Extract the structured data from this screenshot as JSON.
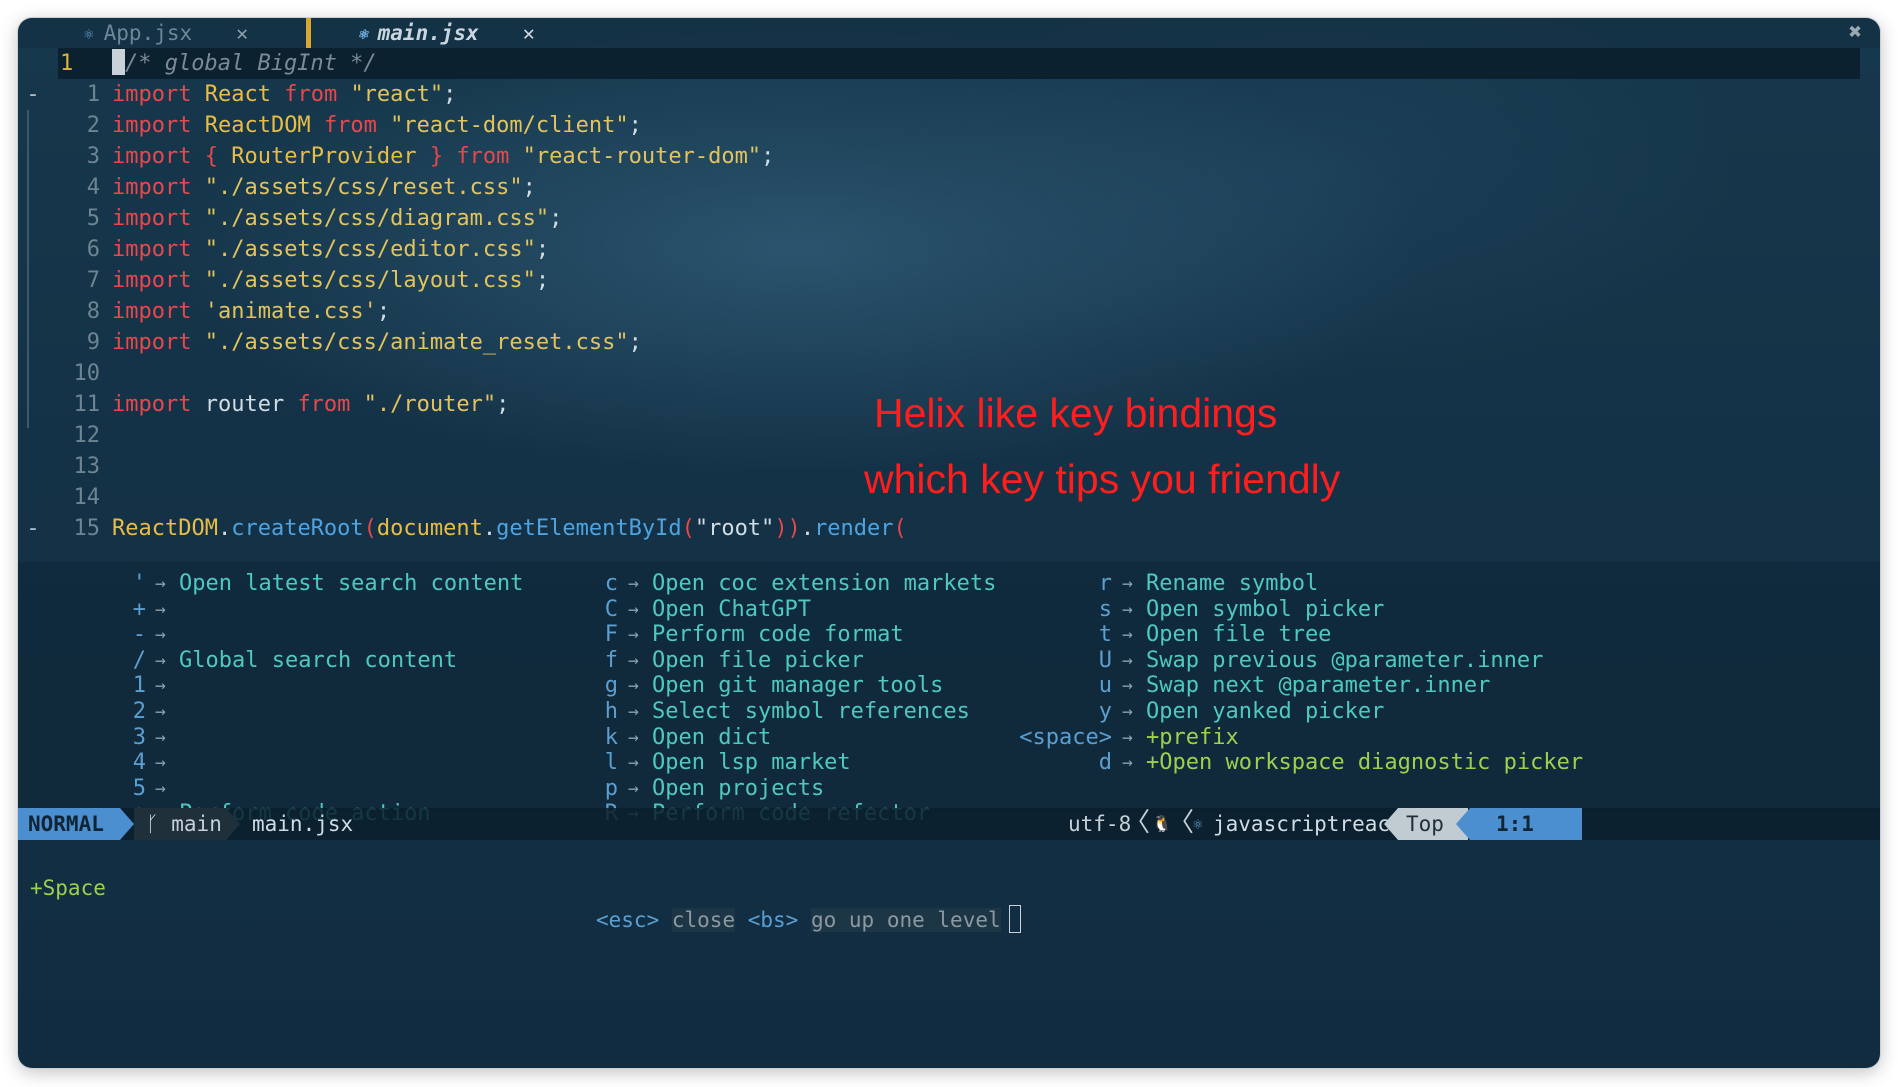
{
  "tabs": [
    {
      "label": "App.jsx",
      "icon": "react-icon"
    },
    {
      "label": "main.jsx",
      "icon": "react-icon",
      "active": true
    }
  ],
  "editor": {
    "current_line": "1",
    "lines": [
      {
        "num": "",
        "gutter": "",
        "parts": [
          {
            "t": "/* global BigInt */",
            "c": "cmt"
          }
        ],
        "cursor": true
      },
      {
        "num": "1",
        "gutter": "-",
        "parts": [
          {
            "t": "import ",
            "c": "kw"
          },
          {
            "t": "React ",
            "c": "cls"
          },
          {
            "t": "from ",
            "c": "kw"
          },
          {
            "t": "\"react\"",
            "c": "str"
          },
          {
            "t": ";",
            "c": "plain"
          }
        ]
      },
      {
        "num": "2",
        "gutter": "",
        "parts": [
          {
            "t": "import ",
            "c": "kw"
          },
          {
            "t": "ReactDOM ",
            "c": "cls"
          },
          {
            "t": "from ",
            "c": "kw"
          },
          {
            "t": "\"react-dom/client\"",
            "c": "str"
          },
          {
            "t": ";",
            "c": "plain"
          }
        ]
      },
      {
        "num": "3",
        "gutter": "",
        "parts": [
          {
            "t": "import ",
            "c": "kw"
          },
          {
            "t": "{ ",
            "c": "kw"
          },
          {
            "t": "RouterProvider ",
            "c": "cls"
          },
          {
            "t": "} ",
            "c": "kw"
          },
          {
            "t": "from ",
            "c": "kw"
          },
          {
            "t": "\"react-router-dom\"",
            "c": "str"
          },
          {
            "t": ";",
            "c": "plain"
          }
        ]
      },
      {
        "num": "4",
        "gutter": "",
        "parts": [
          {
            "t": "import ",
            "c": "kw"
          },
          {
            "t": "\"./assets/css/reset.css\"",
            "c": "str"
          },
          {
            "t": ";",
            "c": "plain"
          }
        ]
      },
      {
        "num": "5",
        "gutter": "",
        "parts": [
          {
            "t": "import ",
            "c": "kw"
          },
          {
            "t": "\"./assets/css/diagram.css\"",
            "c": "str"
          },
          {
            "t": ";",
            "c": "plain"
          }
        ]
      },
      {
        "num": "6",
        "gutter": "",
        "parts": [
          {
            "t": "import ",
            "c": "kw"
          },
          {
            "t": "\"./assets/css/editor.css\"",
            "c": "str"
          },
          {
            "t": ";",
            "c": "plain"
          }
        ]
      },
      {
        "num": "7",
        "gutter": "",
        "parts": [
          {
            "t": "import ",
            "c": "kw"
          },
          {
            "t": "\"./assets/css/layout.css\"",
            "c": "str"
          },
          {
            "t": ";",
            "c": "plain"
          }
        ]
      },
      {
        "num": "8",
        "gutter": "",
        "parts": [
          {
            "t": "import ",
            "c": "kw"
          },
          {
            "t": "'animate.css'",
            "c": "str"
          },
          {
            "t": ";",
            "c": "plain"
          }
        ]
      },
      {
        "num": "9",
        "gutter": "",
        "parts": [
          {
            "t": "import ",
            "c": "kw"
          },
          {
            "t": "\"./assets/css/animate_reset.css\"",
            "c": "str"
          },
          {
            "t": ";",
            "c": "plain"
          }
        ]
      },
      {
        "num": "10",
        "gutter": "",
        "parts": []
      },
      {
        "num": "11",
        "gutter": "",
        "parts": [
          {
            "t": "import ",
            "c": "kw"
          },
          {
            "t": "router ",
            "c": "plain"
          },
          {
            "t": "from ",
            "c": "kw"
          },
          {
            "t": "\"./router\"",
            "c": "str"
          },
          {
            "t": ";",
            "c": "plain"
          }
        ]
      },
      {
        "num": "12",
        "gutter": "",
        "parts": []
      },
      {
        "num": "13",
        "gutter": "",
        "parts": []
      },
      {
        "num": "14",
        "gutter": "",
        "parts": []
      },
      {
        "num": "15",
        "gutter": "-",
        "parts": [
          {
            "t": "ReactDOM",
            "c": "cls"
          },
          {
            "t": ".",
            "c": "plain"
          },
          {
            "t": "createRoot",
            "c": "fn"
          },
          {
            "t": "(",
            "c": "kw"
          },
          {
            "t": "document",
            "c": "cls"
          },
          {
            "t": ".",
            "c": "plain"
          },
          {
            "t": "getElementById",
            "c": "fn"
          },
          {
            "t": "(",
            "c": "kw"
          },
          {
            "t": "\"root\"",
            "c": "plain"
          },
          {
            "t": "))",
            "c": "kw"
          },
          {
            "t": ".",
            "c": "plain"
          },
          {
            "t": "render",
            "c": "fn"
          },
          {
            "t": "(",
            "c": "kw"
          }
        ]
      }
    ]
  },
  "annotations": {
    "line1": "Helix like key bindings",
    "line2": "which key tips you friendly"
  },
  "which_key": {
    "columns": [
      [
        {
          "key": "'",
          "desc": "Open latest search content"
        },
        {
          "key": "+",
          "desc": ""
        },
        {
          "key": "-",
          "desc": ""
        },
        {
          "key": "/",
          "desc": "Global search content"
        },
        {
          "key": "1",
          "desc": ""
        },
        {
          "key": "2",
          "desc": ""
        },
        {
          "key": "3",
          "desc": ""
        },
        {
          "key": "4",
          "desc": ""
        },
        {
          "key": "5",
          "desc": ""
        },
        {
          "key": "a",
          "desc": "Perform code action"
        }
      ],
      [
        {
          "key": "c",
          "desc": "Open coc extension markets"
        },
        {
          "key": "C",
          "desc": "Open ChatGPT"
        },
        {
          "key": "F",
          "desc": "Perform code format"
        },
        {
          "key": "f",
          "desc": "Open file picker"
        },
        {
          "key": "g",
          "desc": "Open git manager tools"
        },
        {
          "key": "h",
          "desc": "Select symbol references"
        },
        {
          "key": "k",
          "desc": "Open dict"
        },
        {
          "key": "l",
          "desc": "Open lsp market"
        },
        {
          "key": "p",
          "desc": "Open projects"
        },
        {
          "key": "R",
          "desc": "Perform code refector"
        }
      ],
      [
        {
          "key": "r",
          "desc": "Rename symbol"
        },
        {
          "key": "s",
          "desc": "Open symbol picker"
        },
        {
          "key": "t",
          "desc": "Open file tree"
        },
        {
          "key": "U",
          "desc": "Swap previous @parameter.inner"
        },
        {
          "key": "u",
          "desc": "Swap next @parameter.inner"
        },
        {
          "key": "y",
          "desc": "Open yanked picker"
        },
        {
          "key": "<space>",
          "desc": "+prefix",
          "group": true
        },
        {
          "key": "d",
          "desc": "+Open workspace diagnostic picker",
          "group": true
        }
      ]
    ]
  },
  "statusline": {
    "mode": "NORMAL",
    "branch_icon": "git-branch-icon",
    "branch": "main",
    "filename": "main.jsx",
    "encoding": "utf-8",
    "os_icon": "linux-icon",
    "filetype_icon": "react-icon",
    "filetype": "javascriptreact",
    "scroll": "Top",
    "position": "1:1"
  },
  "cmdline": {
    "prefix": "+Space",
    "esc_key": "<esc>",
    "esc_desc": "close",
    "bs_key": "<bs>",
    "bs_desc": "go up one level"
  },
  "colors": {
    "keyword": "#e8474d",
    "string": "#e2c35d",
    "function": "#4ea3e0",
    "annotation": "#ff1e1e",
    "mode_bg": "#4b8fd1",
    "which_key_desc": "#4fc9bf",
    "group_desc": "#9ed04f"
  }
}
